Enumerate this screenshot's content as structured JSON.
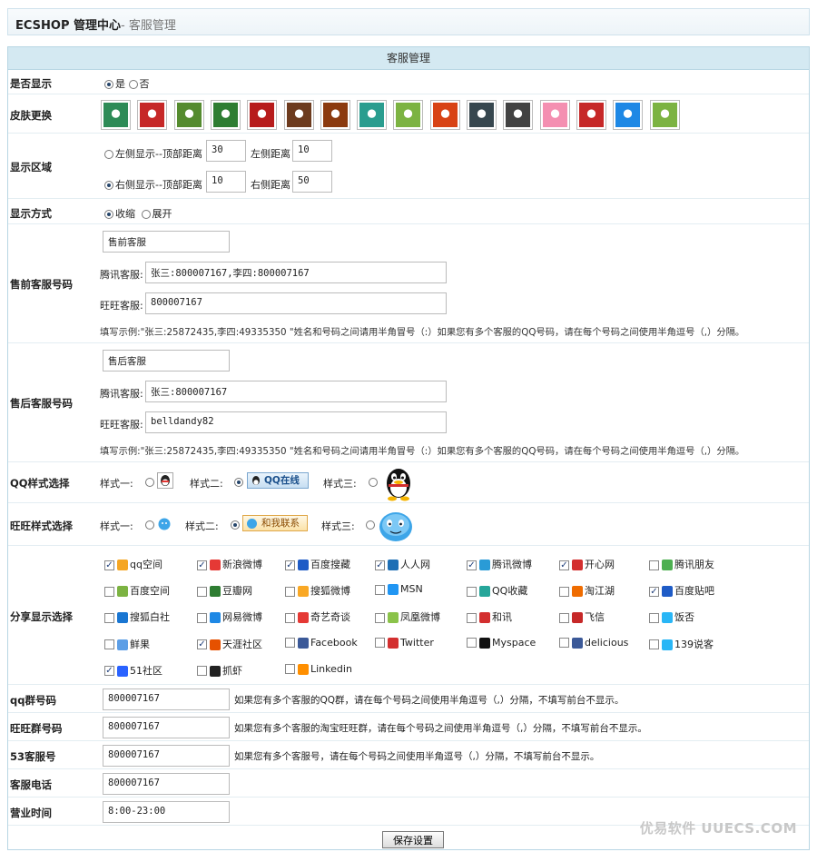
{
  "header": {
    "title": "ECSHOP 管理中心",
    "subtitle": "- 客服管理"
  },
  "caption": "客服管理",
  "rows": {
    "show": {
      "label": "是否显示",
      "yes": "是",
      "no": "否"
    },
    "skin": {
      "label": "皮肤更换",
      "skins": [
        {
          "name": "skin-1",
          "color": "#2e8b57"
        },
        {
          "name": "skin-2",
          "color": "#c62828"
        },
        {
          "name": "skin-3",
          "color": "#558b2f"
        },
        {
          "name": "skin-4",
          "color": "#2e7d32"
        },
        {
          "name": "skin-5",
          "color": "#b71c1c"
        },
        {
          "name": "skin-6",
          "color": "#6d3b1e"
        },
        {
          "name": "skin-7",
          "color": "#8b3a0f"
        },
        {
          "name": "skin-8",
          "color": "#2a9d8f"
        },
        {
          "name": "skin-9",
          "color": "#7cb342"
        },
        {
          "name": "skin-10",
          "color": "#d84315"
        },
        {
          "name": "skin-11",
          "color": "#37474f"
        },
        {
          "name": "skin-12",
          "color": "#424242"
        },
        {
          "name": "skin-13",
          "color": "#f48fb1"
        },
        {
          "name": "skin-14",
          "color": "#c62828"
        },
        {
          "name": "skin-15",
          "color": "#1e88e5"
        },
        {
          "name": "skin-16",
          "color": "#7cb342"
        }
      ]
    },
    "area": {
      "label": "显示区域",
      "left_opt": "左侧显示--顶部距离",
      "left_top": "30",
      "left_side_label": "左侧距离",
      "left_side": "10",
      "right_opt": "右侧显示--顶部距离",
      "right_top": "10",
      "right_side_label": "右侧距离",
      "right_side": "50"
    },
    "mode": {
      "label": "显示方式",
      "collapse": "收缩",
      "expand": "展开"
    },
    "presale": {
      "label": "售前客服号码",
      "title_value": "售前客服",
      "qq_label": "腾讯客服:",
      "qq_value": "张三:800007167,李四:800007167",
      "ww_label": "旺旺客服:",
      "ww_value": "800007167",
      "hint": "填写示例:\"张三:25872435,李四:49335350 \"姓名和号码之间请用半角冒号（:）如果您有多个客服的QQ号码，请在每个号码之间使用半角逗号（,）分隔。"
    },
    "aftersale": {
      "label": "售后客服号码",
      "title_value": "售后客服",
      "qq_label": "腾讯客服:",
      "qq_value": "张三:800007167",
      "ww_label": "旺旺客服:",
      "ww_value": "belldandy82",
      "hint": "填写示例:\"张三:25872435,李四:49335350 \"姓名和号码之间请用半角冒号（:）如果您有多个客服的QQ号码，请在每个号码之间使用半角逗号（,）分隔。"
    },
    "qqstyle": {
      "label": "QQ样式选择",
      "s1": "样式一:",
      "s2": "样式二:",
      "s3": "样式三:",
      "badge": "QQ在线"
    },
    "wwstyle": {
      "label": "旺旺样式选择",
      "s1": "样式一:",
      "s2": "样式二:",
      "s3": "样式三:",
      "badge": "和我联系"
    },
    "share": {
      "label": "分享显示选择",
      "items": [
        {
          "name": "qq空间",
          "checked": true,
          "color": "#f5a623"
        },
        {
          "name": "新浪微博",
          "checked": true,
          "color": "#e53935"
        },
        {
          "name": "百度搜藏",
          "checked": true,
          "color": "#1e5bc6"
        },
        {
          "name": "人人网",
          "checked": true,
          "color": "#1e6fb5"
        },
        {
          "name": "腾讯微博",
          "checked": true,
          "color": "#2a9bd6"
        },
        {
          "name": "开心网",
          "checked": true,
          "color": "#d32f2f"
        },
        {
          "name": "腾讯朋友",
          "checked": false,
          "color": "#4caf50"
        },
        {
          "name": "百度空间",
          "checked": false,
          "color": "#7cb342"
        },
        {
          "name": "豆瓣网",
          "checked": false,
          "color": "#2e7d32"
        },
        {
          "name": "搜狐微博",
          "checked": false,
          "color": "#f9a825"
        },
        {
          "name": "MSN",
          "checked": false,
          "color": "#2196f3"
        },
        {
          "name": "QQ收藏",
          "checked": false,
          "color": "#26a69a"
        },
        {
          "name": "淘江湖",
          "checked": false,
          "color": "#ef6c00"
        },
        {
          "name": "百度贴吧",
          "checked": true,
          "color": "#1e5bc6"
        },
        {
          "name": "搜狐白社",
          "checked": false,
          "color": "#1976d2"
        },
        {
          "name": "网易微博",
          "checked": false,
          "color": "#1e88e5"
        },
        {
          "name": "奇艺奇谈",
          "checked": false,
          "color": "#e53935"
        },
        {
          "name": "凤凰微博",
          "checked": false,
          "color": "#8bc34a"
        },
        {
          "name": "和讯",
          "checked": false,
          "color": "#d32f2f"
        },
        {
          "name": "飞信",
          "checked": false,
          "color": "#c62828"
        },
        {
          "name": "饭否",
          "checked": false,
          "color": "#29b6f6"
        },
        {
          "name": "鲜果",
          "checked": false,
          "color": "#5c9ee6"
        },
        {
          "name": "天涯社区",
          "checked": true,
          "color": "#e65100"
        },
        {
          "name": "Facebook",
          "checked": false,
          "color": "#3b5998"
        },
        {
          "name": "Twitter",
          "checked": false,
          "color": "#d32f2f"
        },
        {
          "name": "Myspace",
          "checked": false,
          "color": "#111111"
        },
        {
          "name": "delicious",
          "checked": false,
          "color": "#3b5998"
        },
        {
          "name": "139说客",
          "checked": false,
          "color": "#29b6f6"
        },
        {
          "name": "51社区",
          "checked": true,
          "color": "#2962ff"
        },
        {
          "name": "抓虾",
          "checked": false,
          "color": "#222222"
        },
        {
          "name": "Linkedin",
          "checked": false,
          "color": "#ff8f00"
        }
      ]
    },
    "qqgroup": {
      "label": "qq群号码",
      "value": "800007167",
      "hint": "如果您有多个客服的QQ群，请在每个号码之间使用半角逗号（,）分隔，不填写前台不显示。"
    },
    "wwgroup": {
      "label": "旺旺群号码",
      "value": "800007167",
      "hint": "如果您有多个客服的淘宝旺旺群，请在每个号码之间使用半角逗号（,）分隔，不填写前台不显示。"
    },
    "kf53": {
      "label": "53客服号",
      "value": "800007167",
      "hint": "如果您有多个客服号，请在每个号码之间使用半角逗号（,）分隔，不填写前台不显示。"
    },
    "phone": {
      "label": "客服电话",
      "value": "800007167"
    },
    "hours": {
      "label": "营业时间",
      "value": "8:00-23:00"
    }
  },
  "save_label": "保存设置",
  "watermark": "优易软件 UUECS.COM"
}
